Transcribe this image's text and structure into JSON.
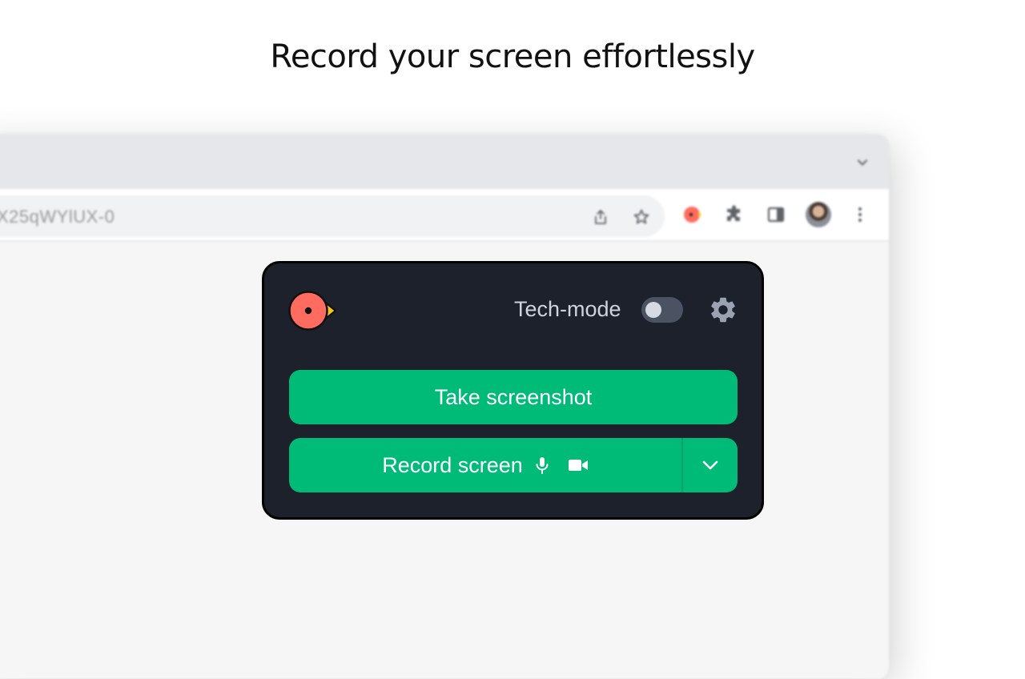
{
  "page": {
    "headline": "Record your screen effortlessly"
  },
  "browser": {
    "address_text": "X25qWYlUX-0",
    "toolbar_icons": [
      "share-icon",
      "bookmark-star-icon",
      "extension-logo-icon",
      "extensions-puzzle-icon",
      "side-panel-icon",
      "profile-avatar",
      "kebab-menu-icon"
    ],
    "tabstrip_icons": [
      "chevron-down-icon"
    ]
  },
  "popup": {
    "tech_mode_label": "Tech-mode",
    "tech_mode_enabled": false,
    "screenshot_label": "Take screenshot",
    "record_label": "Record screen",
    "record_icons": [
      "microphone-icon",
      "video-camera-icon"
    ],
    "dropdown_icon": "chevron-down-icon",
    "settings_icon": "gear-icon",
    "logo_icon": "bird-logo-icon"
  },
  "colors": {
    "popup_bg": "#1c212b",
    "accent_green": "#00bb77",
    "logo_red": "#ff6b5e",
    "logo_yellow": "#f5c518",
    "toggle_track": "#4b5262"
  }
}
